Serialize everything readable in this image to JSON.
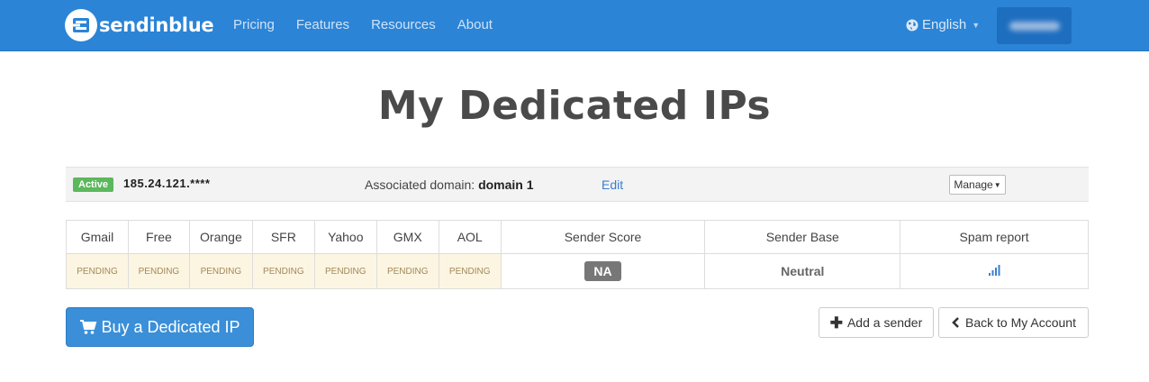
{
  "header": {
    "brand": "sendinblue",
    "nav": [
      "Pricing",
      "Features",
      "Resources",
      "About"
    ],
    "language": "English"
  },
  "page": {
    "title": "My Dedicated IPs"
  },
  "ip": {
    "status": "Active",
    "address": "185.24.121.****",
    "assoc_label": "Associated domain:",
    "domain": "domain 1",
    "edit_label": "Edit",
    "manage_label": "Manage"
  },
  "table": {
    "providers": [
      {
        "name": "Gmail",
        "status": "PENDING"
      },
      {
        "name": "Free",
        "status": "PENDING"
      },
      {
        "name": "Orange",
        "status": "PENDING"
      },
      {
        "name": "SFR",
        "status": "PENDING"
      },
      {
        "name": "Yahoo",
        "status": "PENDING"
      },
      {
        "name": "GMX",
        "status": "PENDING"
      },
      {
        "name": "AOL",
        "status": "PENDING"
      }
    ],
    "sender_score_label": "Sender Score",
    "sender_score_value": "NA",
    "sender_base_label": "Sender Base",
    "sender_base_value": "Neutral",
    "spam_report_label": "Spam report"
  },
  "actions": {
    "buy_label": "Buy a Dedicated IP",
    "add_sender_label": "Add a sender",
    "back_label": "Back to My Account"
  },
  "colors": {
    "navbar": "#2b84d6",
    "active_badge": "#5cb85c",
    "pending_bg": "#fcf5e2",
    "primary_button": "#3a8fd8"
  },
  "icons": [
    "sendinblue-logo-icon",
    "globe-icon",
    "caret-down-icon",
    "bars-chart-icon",
    "cart-icon",
    "plus-icon",
    "chevron-left-icon"
  ]
}
